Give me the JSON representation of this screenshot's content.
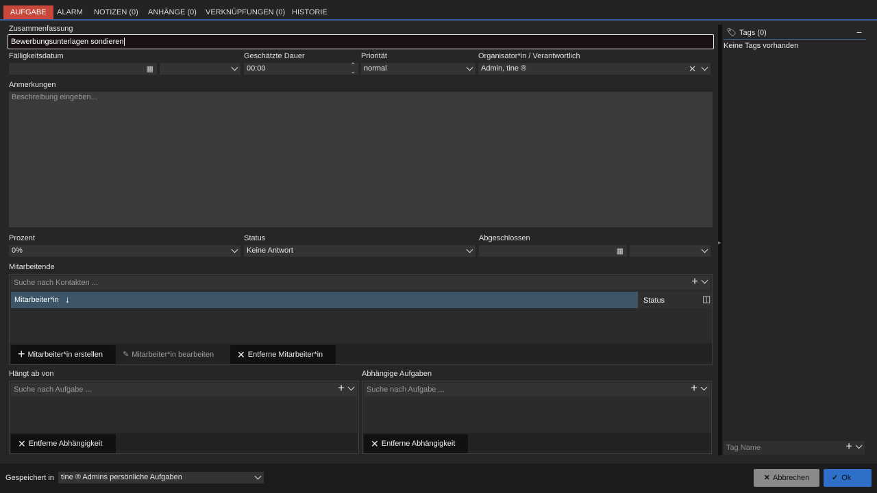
{
  "tabs": [
    {
      "label": "AUFGABE"
    },
    {
      "label": "ALARM"
    },
    {
      "label": "NOTIZEN (0)"
    },
    {
      "label": "ANHÄNGE (0)"
    },
    {
      "label": "VERKNÜPFUNGEN (0)"
    },
    {
      "label": "HISTORIE"
    }
  ],
  "summary": {
    "label": "Zusammenfassung",
    "value": "Bewerbungsunterlagen sondieren"
  },
  "due": {
    "label": "Fälligkeitsdatum",
    "value": "",
    "time": ""
  },
  "duration": {
    "label": "Geschätzte Dauer",
    "value": "00:00"
  },
  "priority": {
    "label": "Priorität",
    "value": "normal"
  },
  "organizer": {
    "label": "Organisator*in / Verantwortlich",
    "value": "Admin, tine ®"
  },
  "notes": {
    "label": "Anmerkungen",
    "placeholder": "Beschreibung eingeben..."
  },
  "percent": {
    "label": "Prozent",
    "value": "0%"
  },
  "status": {
    "label": "Status",
    "value": "Keine Antwort"
  },
  "completed": {
    "label": "Abgeschlossen",
    "value": ""
  },
  "staff": {
    "label": "Mitarbeitende",
    "search_placeholder": "Suche nach Kontakten ...",
    "col_name": "Mitarbeiter*in",
    "col_status": "Status",
    "btn_create": "Mitarbeiter*in erstellen",
    "btn_edit": "Mitarbeiter*in bearbeiten",
    "btn_remove": "Entferne Mitarbeiter*in"
  },
  "depends": {
    "label": "Hängt ab von",
    "search_placeholder": "Suche nach Aufgabe ...",
    "btn_remove": "Entferne Abhängigkeit"
  },
  "dependents": {
    "label": "Abhängige Aufgaben",
    "search_placeholder": "Suche nach Aufgabe ...",
    "btn_remove": "Entferne Abhängigkeit"
  },
  "tags": {
    "title": "Tags (0)",
    "empty": "Keine Tags vorhanden",
    "input_placeholder": "Tag Name"
  },
  "footer": {
    "saved_in_label": "Gespeichert in",
    "saved_in_value": "tine ® Admins persönliche Aufgaben",
    "cancel": "Abbrechen",
    "ok": "Ok"
  },
  "colors": {
    "accent_tab": "#c9483b",
    "tab_underline": "#3a5e98",
    "ok_button": "#2d6fc9",
    "table_header": "#3d5566"
  }
}
